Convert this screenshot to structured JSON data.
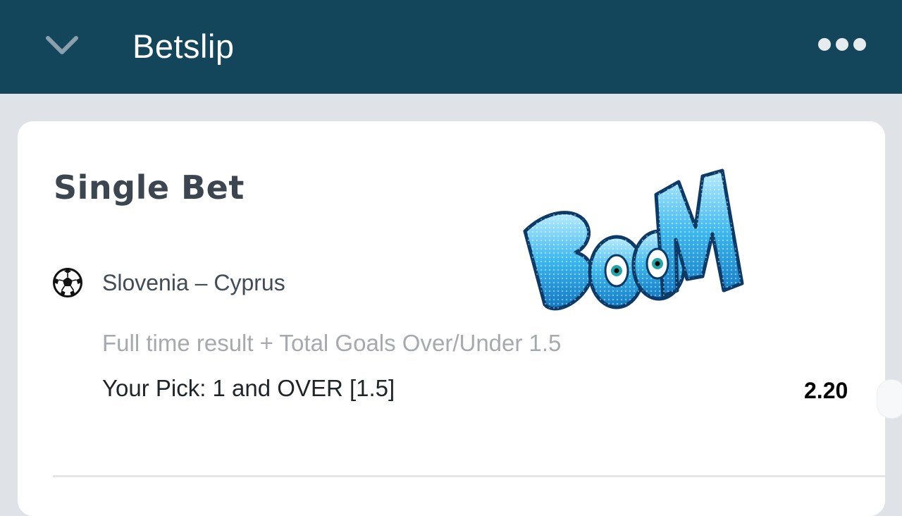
{
  "header": {
    "title": "Betslip",
    "collapse_icon": "chevron-down-icon",
    "menu_icon": "more-dots-icon"
  },
  "card": {
    "heading": "Single Bet",
    "sport_icon": "soccer-ball-icon",
    "match": "Slovenia – Cyprus",
    "market": "Full time result + Total Goals Over/Under 1.5",
    "pick": "Your Pick: 1 and OVER [1.5]",
    "odds": "2.20"
  },
  "sticker": {
    "text": "BOOM"
  },
  "colors": {
    "header_bg": "#13455b",
    "page_bg": "#dfe3e8",
    "card_bg": "#ffffff",
    "sticker_blue": "#1a9ad6"
  }
}
